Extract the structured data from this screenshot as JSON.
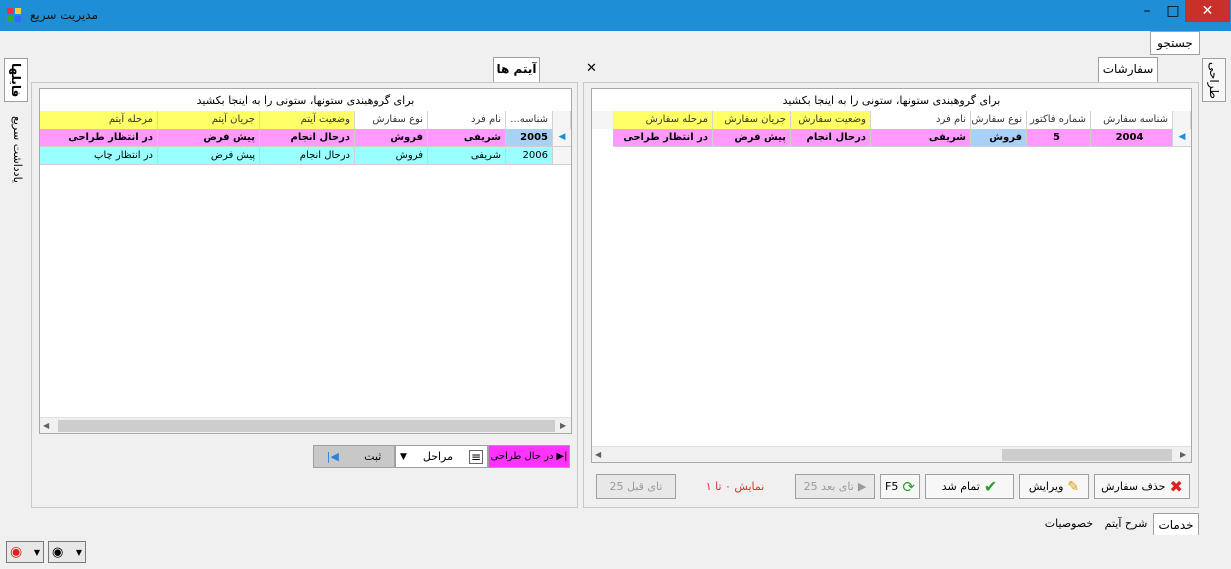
{
  "window": {
    "title": "مدیریت سریع",
    "min": "–",
    "max": "□",
    "close": "✕"
  },
  "search_button": "جستجو",
  "side_tabs": {
    "right": "طراحی",
    "left_top": "فایلها",
    "left_bottom": "یادداشت سریع"
  },
  "orders_panel": {
    "tab": "سفارشات",
    "group_hint": "برای گروهبندی ستونها، ستونی را به اینجا بکشید",
    "columns": [
      "شناسه سفارش",
      "شماره فاکتور",
      "نوع سفارش",
      "نام فرد",
      "وضعیت سفارش",
      "جریان سفارش",
      "مرحله سفارش"
    ],
    "rows": [
      [
        "2004",
        "5",
        "فروش",
        "شریفی",
        "درحال انجام",
        "پیش فرض",
        "در انتظار طراحی"
      ]
    ],
    "buttons": {
      "delete": "حذف سفارش",
      "edit": "ویرایش",
      "done": "تمام شد",
      "refresh": "F5",
      "next": "25 تای بعد",
      "prev": "25 تای قبل"
    },
    "paging": "نمایش ۰ تا ۱"
  },
  "items_panel": {
    "tab": "آیتم ها",
    "close": "✕",
    "group_hint": "برای گروهبندی ستونها، ستونی را به اینجا بکشید",
    "columns": [
      "شناسه...",
      "نام فرد",
      "نوع سفارش",
      "وضعیت آیتم",
      "جریان آیتم",
      "مرحله آیتم"
    ],
    "rows": [
      [
        "2005",
        "شریفی",
        "فروش",
        "درحال انجام",
        "پیش فرض",
        "در انتظار طراحی"
      ],
      [
        "2006",
        "شریفی",
        "فروش",
        "درحال انجام",
        "پیش فرض",
        "در انتظار چاپ"
      ]
    ],
    "stage_button": "در حال طراحی",
    "stages_label": "مراحل",
    "register_button": "ثبت"
  },
  "bottom_tabs": [
    "خدمات",
    "شرح آیتم",
    "خصوصیات"
  ],
  "colors": {
    "titlebar": "#1e8fd6",
    "highlight_pink": "#ff99ff",
    "highlight_cyan": "#99ffff",
    "header_yellow": "#ffff66"
  }
}
